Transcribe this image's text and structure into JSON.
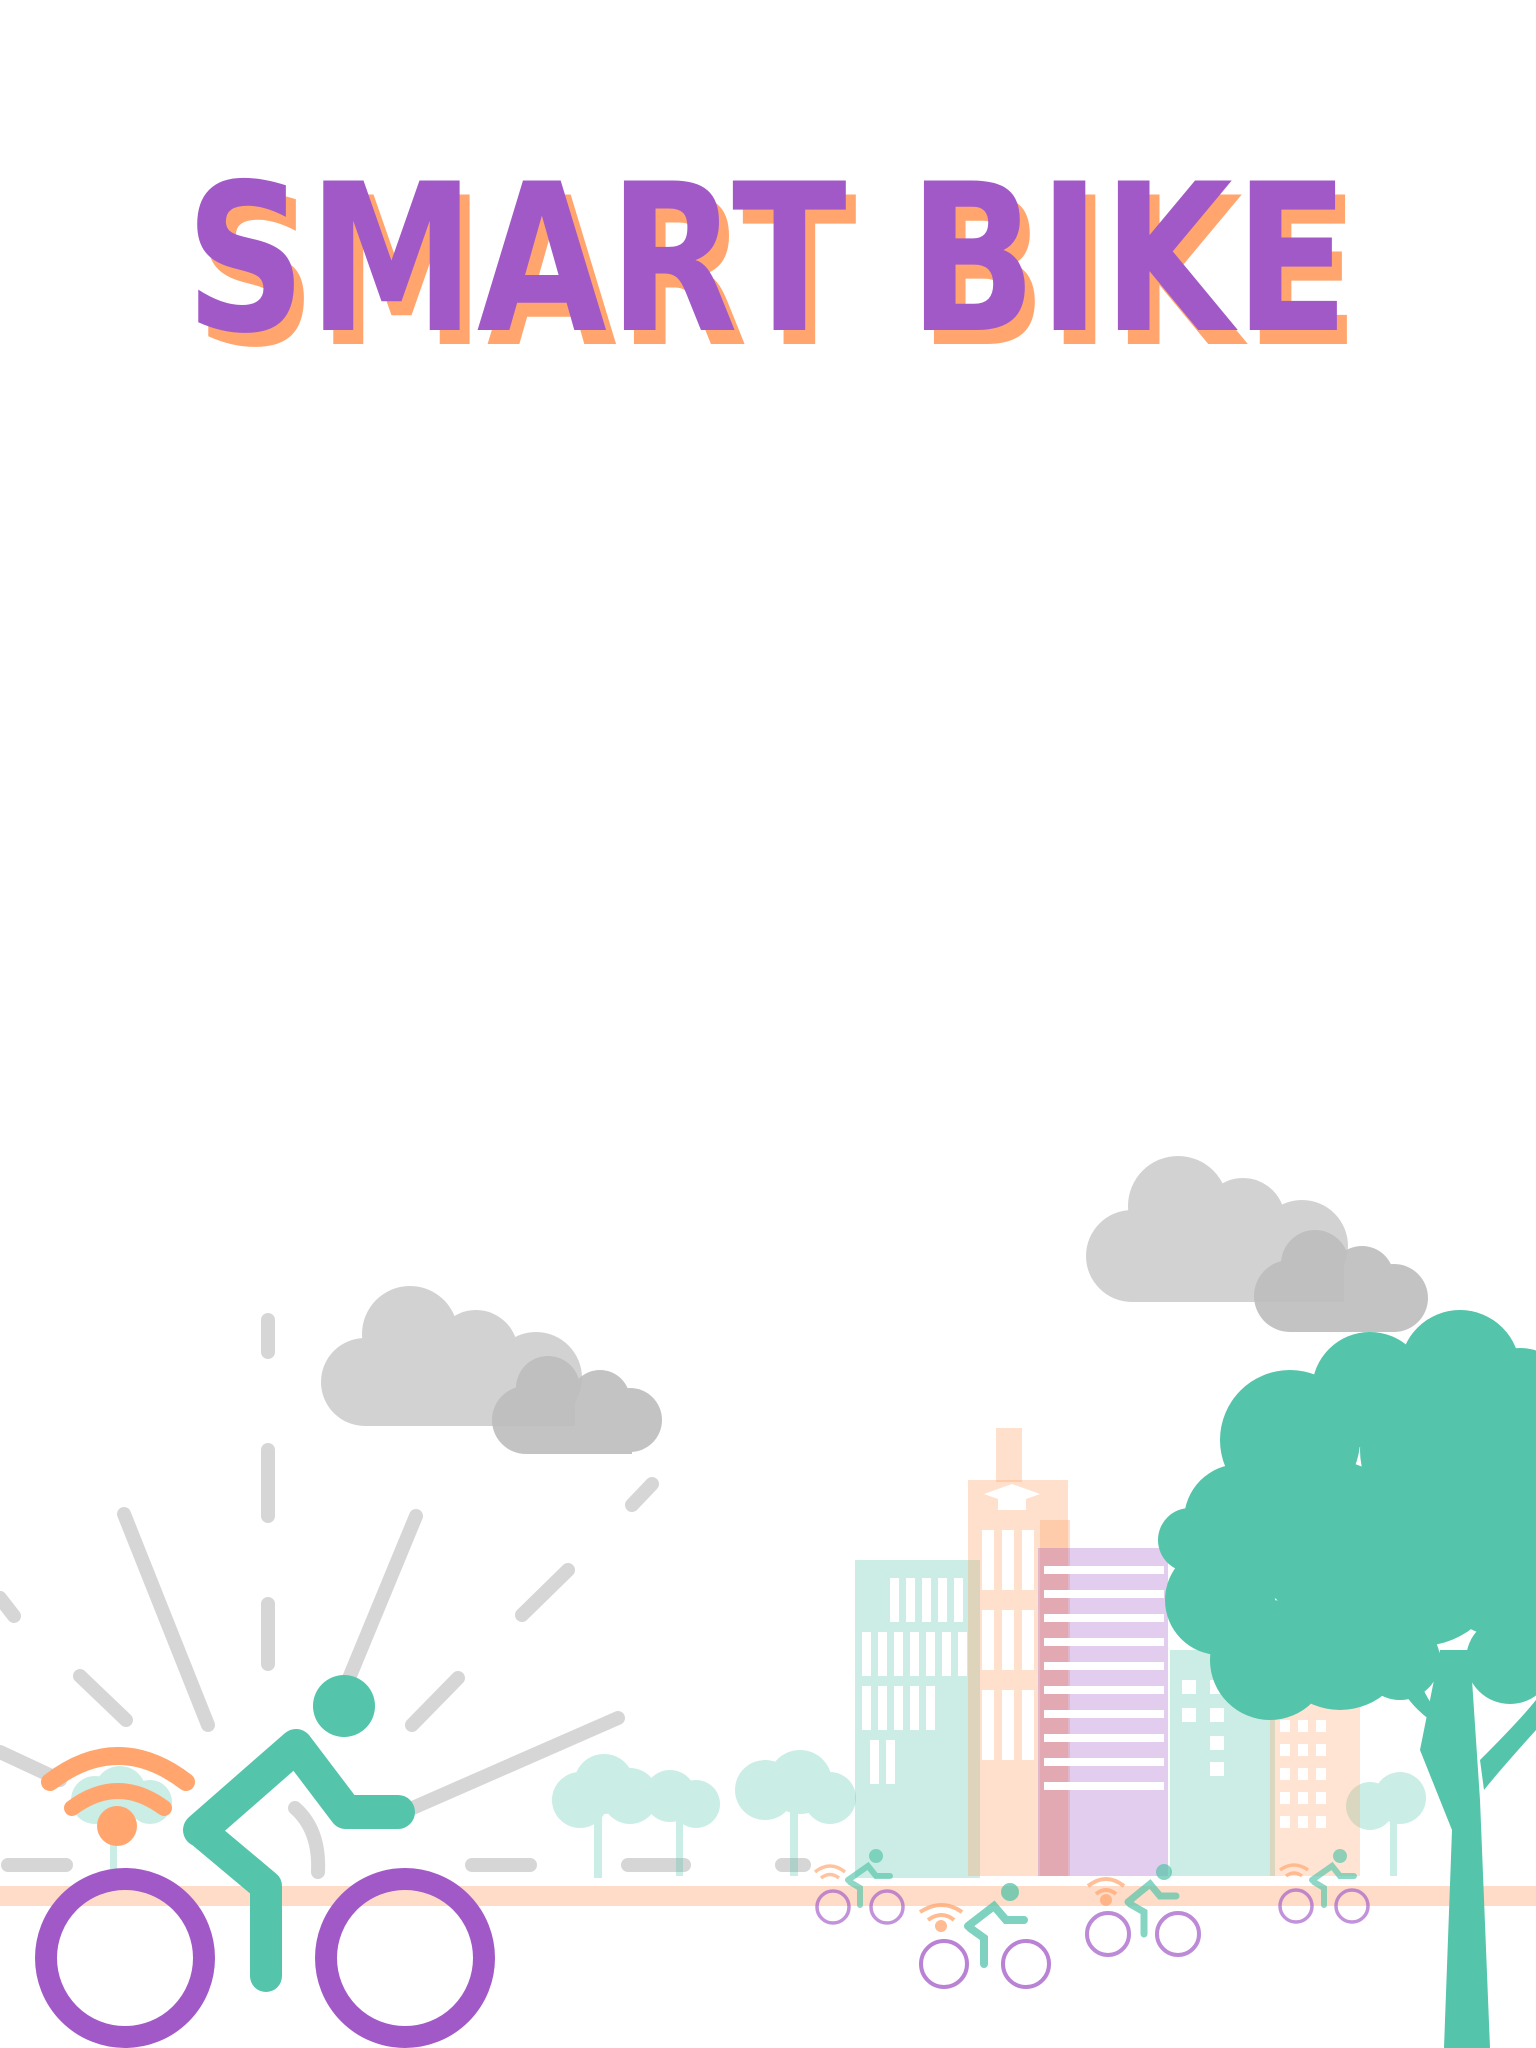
{
  "poster": {
    "title": "SMART BIKE",
    "colors": {
      "title": "#a259c8",
      "title_shadow": "#ffa56d",
      "rider": "#54c4aa",
      "wheel": "#a259c8",
      "signal": "#ffa56d",
      "cloud": "#d2d2d2",
      "rays": "#d6d6d6",
      "road": "#ffdcc8"
    },
    "illustration": {
      "icons": [
        "cloud-icon",
        "wifi-signal-icon",
        "cyclist-icon",
        "tree-icon",
        "building-icon",
        "graduation-cap-icon"
      ]
    }
  }
}
